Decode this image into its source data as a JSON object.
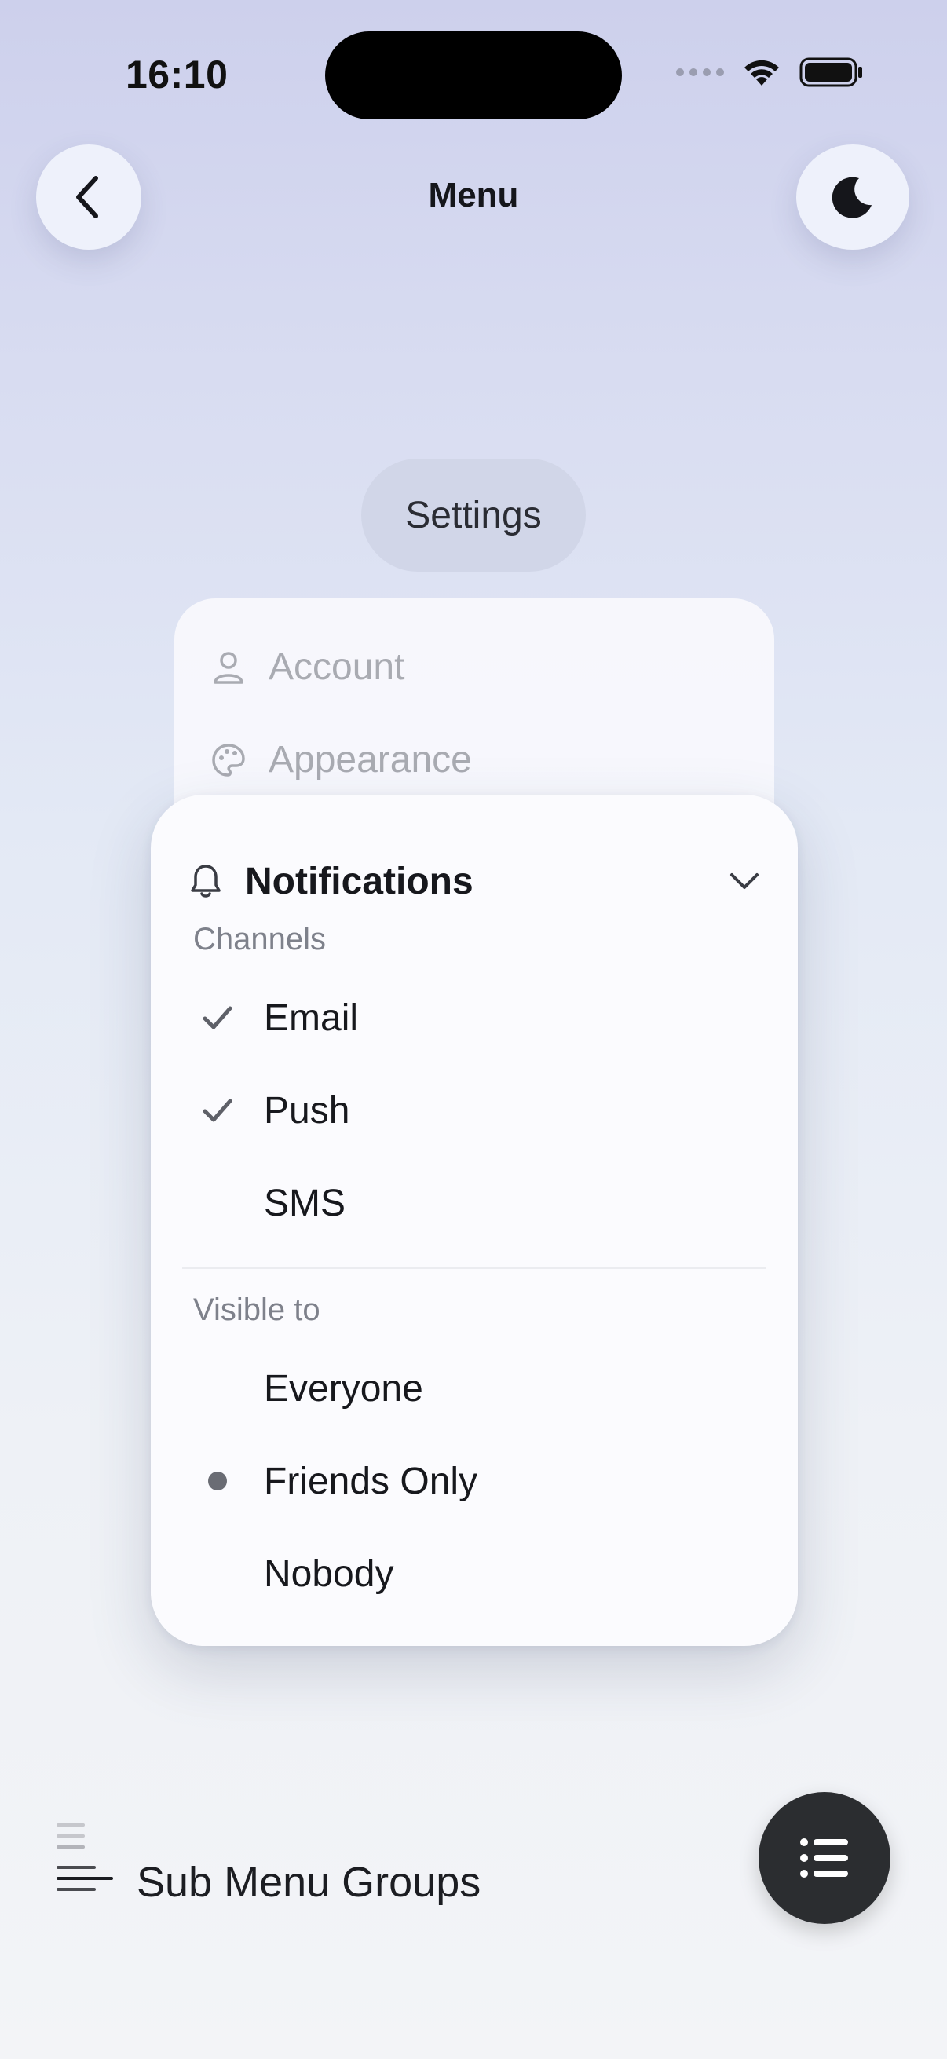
{
  "status_bar": {
    "time": "16:10"
  },
  "header": {
    "title": "Menu"
  },
  "settings_pill": {
    "label": "Settings"
  },
  "background_menu": {
    "items": [
      {
        "label": "Account",
        "icon": "person-icon"
      },
      {
        "label": "Appearance",
        "icon": "palette-icon"
      }
    ]
  },
  "popover": {
    "title": "Notifications",
    "groups": [
      {
        "label": "Channels",
        "options": [
          {
            "label": "Email",
            "checked": true
          },
          {
            "label": "Push",
            "checked": true
          },
          {
            "label": "SMS",
            "checked": false
          }
        ]
      },
      {
        "label": "Visible to",
        "options": [
          {
            "label": "Everyone",
            "selected": false
          },
          {
            "label": "Friends Only",
            "selected": true
          },
          {
            "label": "Nobody",
            "selected": false
          }
        ]
      }
    ]
  },
  "footer": {
    "label": "Sub Menu Groups"
  },
  "colors": {
    "accent_dark": "#2b2d30",
    "check_mark": "#5e6068",
    "muted_text": "#a9abb2",
    "group_label": "#7e818b"
  }
}
